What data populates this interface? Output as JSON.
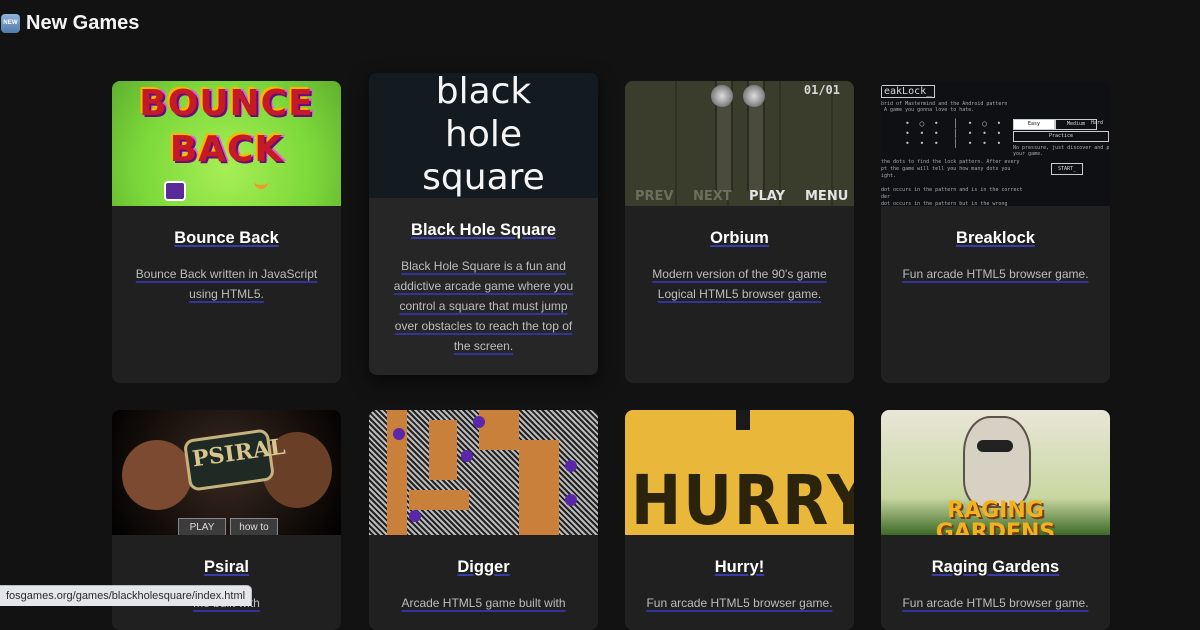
{
  "header": {
    "badge": "NEW",
    "title": "New Games"
  },
  "games": [
    {
      "title": "Bounce Back",
      "description": "Bounce Back written in JavaScript using HTML5.",
      "thumb_text": "BOUNCE BACK"
    },
    {
      "title": "Black Hole Square",
      "description": "Black Hole Square is a fun and addictive arcade game where you control a square that must jump over obstacles to reach the top of the screen.",
      "thumb_text": [
        "black",
        "hole",
        "square"
      ]
    },
    {
      "title": "Orbium",
      "description": "Modern version of the 90's game Logical HTML5 browser game.",
      "thumb_text": {
        "counter": "01/01",
        "buttons": [
          "PREV",
          "NEXT",
          "PLAY",
          "MENU"
        ]
      }
    },
    {
      "title": "Breaklock",
      "description": "Fun arcade HTML5 browser game.",
      "thumb_text": {
        "heading": "eakLock_",
        "options": [
          "Easy",
          "Medium",
          "Hard"
        ],
        "practice": "Practice",
        "start": "START",
        "info": "No pressure, just discover and pract your game."
      }
    },
    {
      "title": "Psiral",
      "description": "me built with",
      "thumb_text": {
        "logo": "PSIRAL",
        "buttons": [
          "PLAY",
          "how to"
        ]
      }
    },
    {
      "title": "Digger",
      "description": "Arcade HTML5 game built with"
    },
    {
      "title": "Hurry!",
      "description": "Fun arcade HTML5 browser game.",
      "thumb_text": "HURRY!"
    },
    {
      "title": "Raging Gardens",
      "description": "Fun arcade HTML5 browser game.",
      "thumb_text": [
        "RAGING",
        "GARDENS"
      ]
    }
  ],
  "status_bar": {
    "url": "fosgames.org/games/blackholesquare/index.html"
  }
}
